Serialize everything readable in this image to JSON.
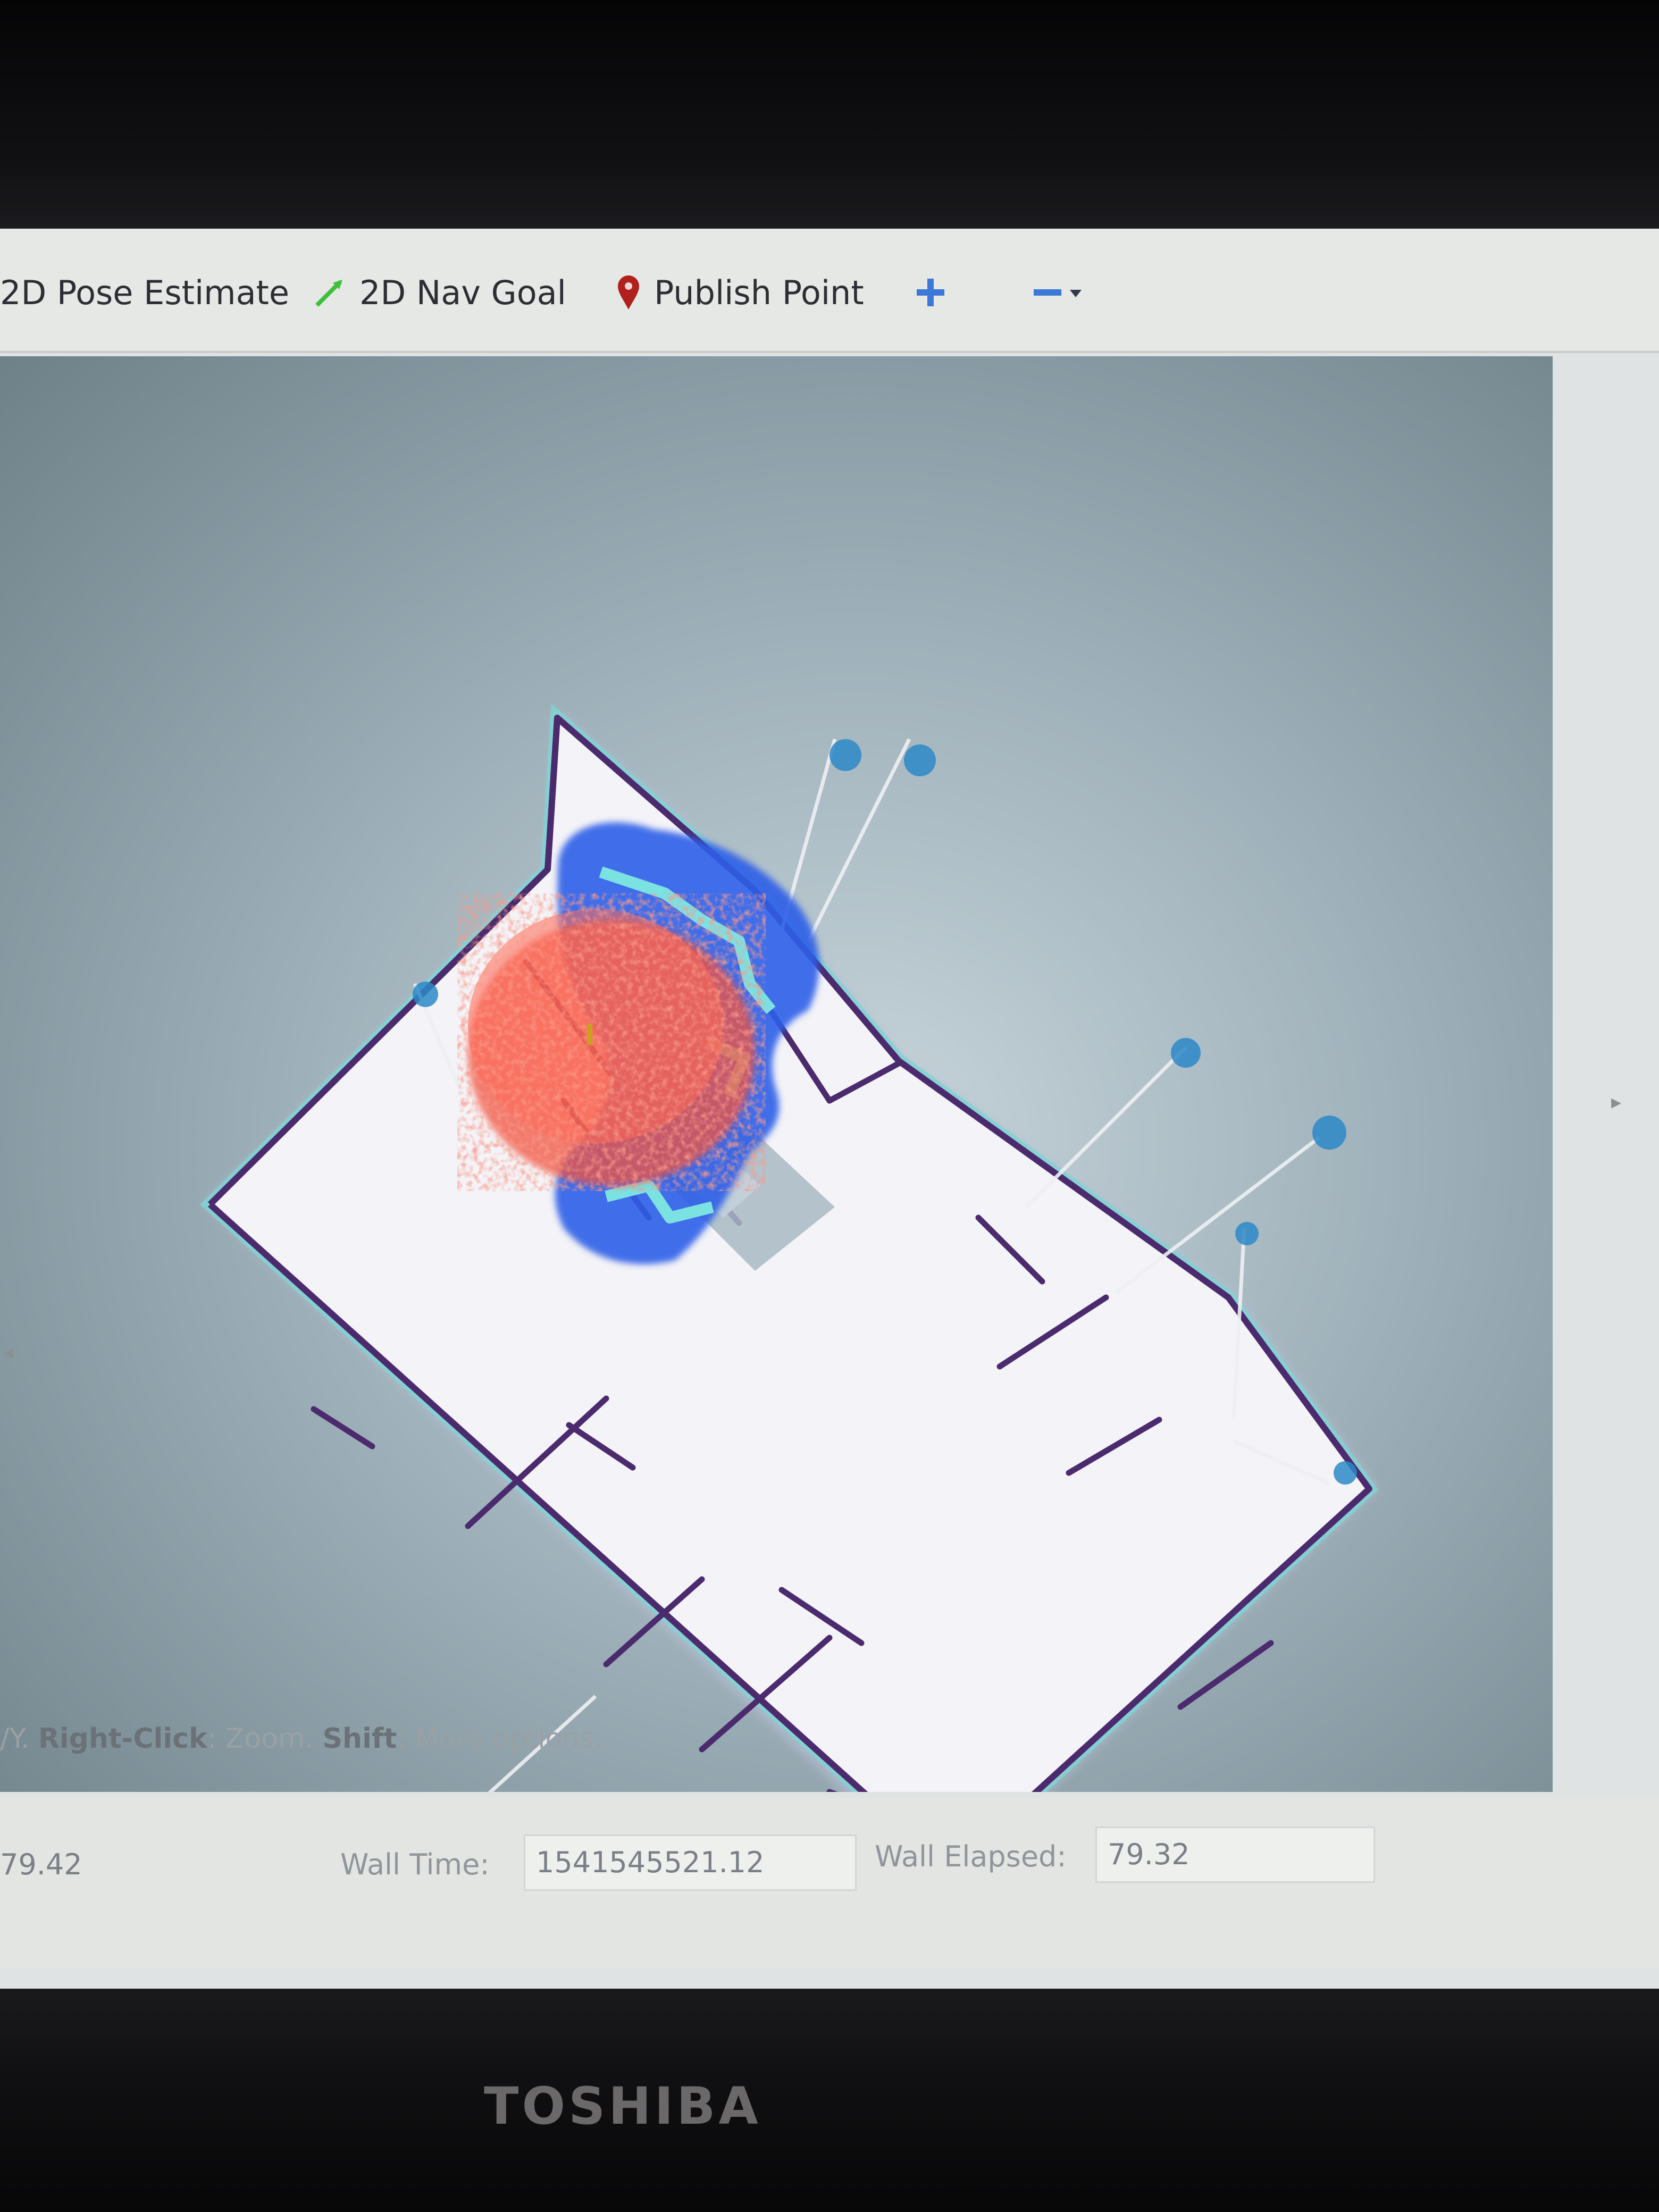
{
  "toolbar": {
    "pose_estimate_label": "2D Pose Estimate",
    "nav_goal_label": "2D Nav Goal",
    "publish_point_label": "Publish Point",
    "icons": {
      "nav_goal": "arrow-icon",
      "publish_point": "map-pin-icon",
      "zoom_in": "plus-icon",
      "zoom_out": "minus-icon",
      "more": "chevron-down-icon"
    }
  },
  "status": {
    "elapsed_partial": "79.42",
    "wall_time_label": "Wall Time:",
    "wall_time_value": "1541545521.12",
    "wall_elapsed_label": "Wall Elapsed:",
    "wall_elapsed_value": "79.32"
  },
  "help": {
    "prefix": "/Y.",
    "right_click_key": "Right-Click",
    "right_click_text": ": Zoom.",
    "shift_key": "Shift",
    "shift_text": ": More options."
  },
  "brand": "TOSHIBA",
  "colors": {
    "particle_cloud": "#f2523f",
    "inflation": "#2f5ee8",
    "map_free": "#f4f3f7",
    "map_wall": "#4b2a6e",
    "costmap_edge": "#7fd3d2",
    "laser": "#eef0f4"
  }
}
